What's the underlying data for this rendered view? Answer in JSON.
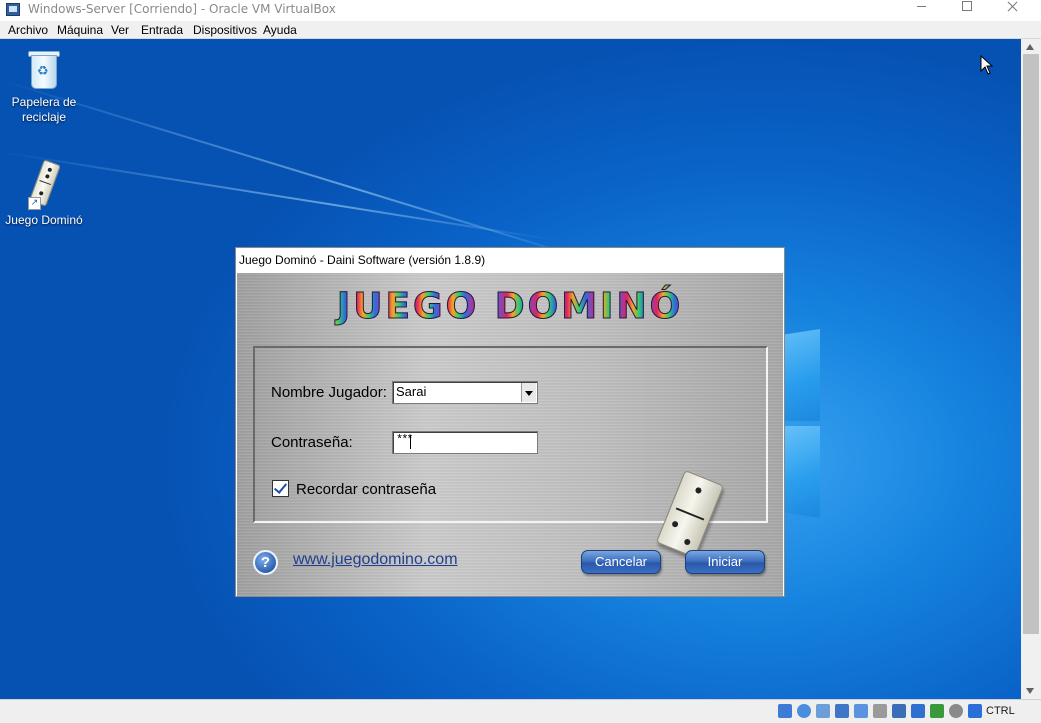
{
  "host_window": {
    "title": "Windows-Server [Corriendo] - Oracle VM VirtualBox",
    "menu": [
      "Archivo",
      "Máquina",
      "Ver",
      "Entrada",
      "Dispositivos",
      "Ayuda"
    ],
    "status_keys": "CTRL"
  },
  "desktop": {
    "icons": [
      {
        "label": "Papelera de reciclaje",
        "icon": "recycle-bin-icon"
      },
      {
        "label": "Juego Dominó",
        "icon": "domino-shortcut-icon"
      }
    ]
  },
  "dialog": {
    "title": "Juego Dominó - Daini Software (versión 1.8.9)",
    "brand": "JUEGO DOMINÓ",
    "player_label": "Nombre Jugador:",
    "player_value": "Sarai",
    "password_label": "Contraseña:",
    "password_value": "***",
    "remember_label": "Recordar contraseña",
    "remember_checked": true,
    "website": "www.juegodomino.com",
    "cancel_label": "Cancelar",
    "start_label": "Iniciar",
    "help_glyph": "?"
  }
}
